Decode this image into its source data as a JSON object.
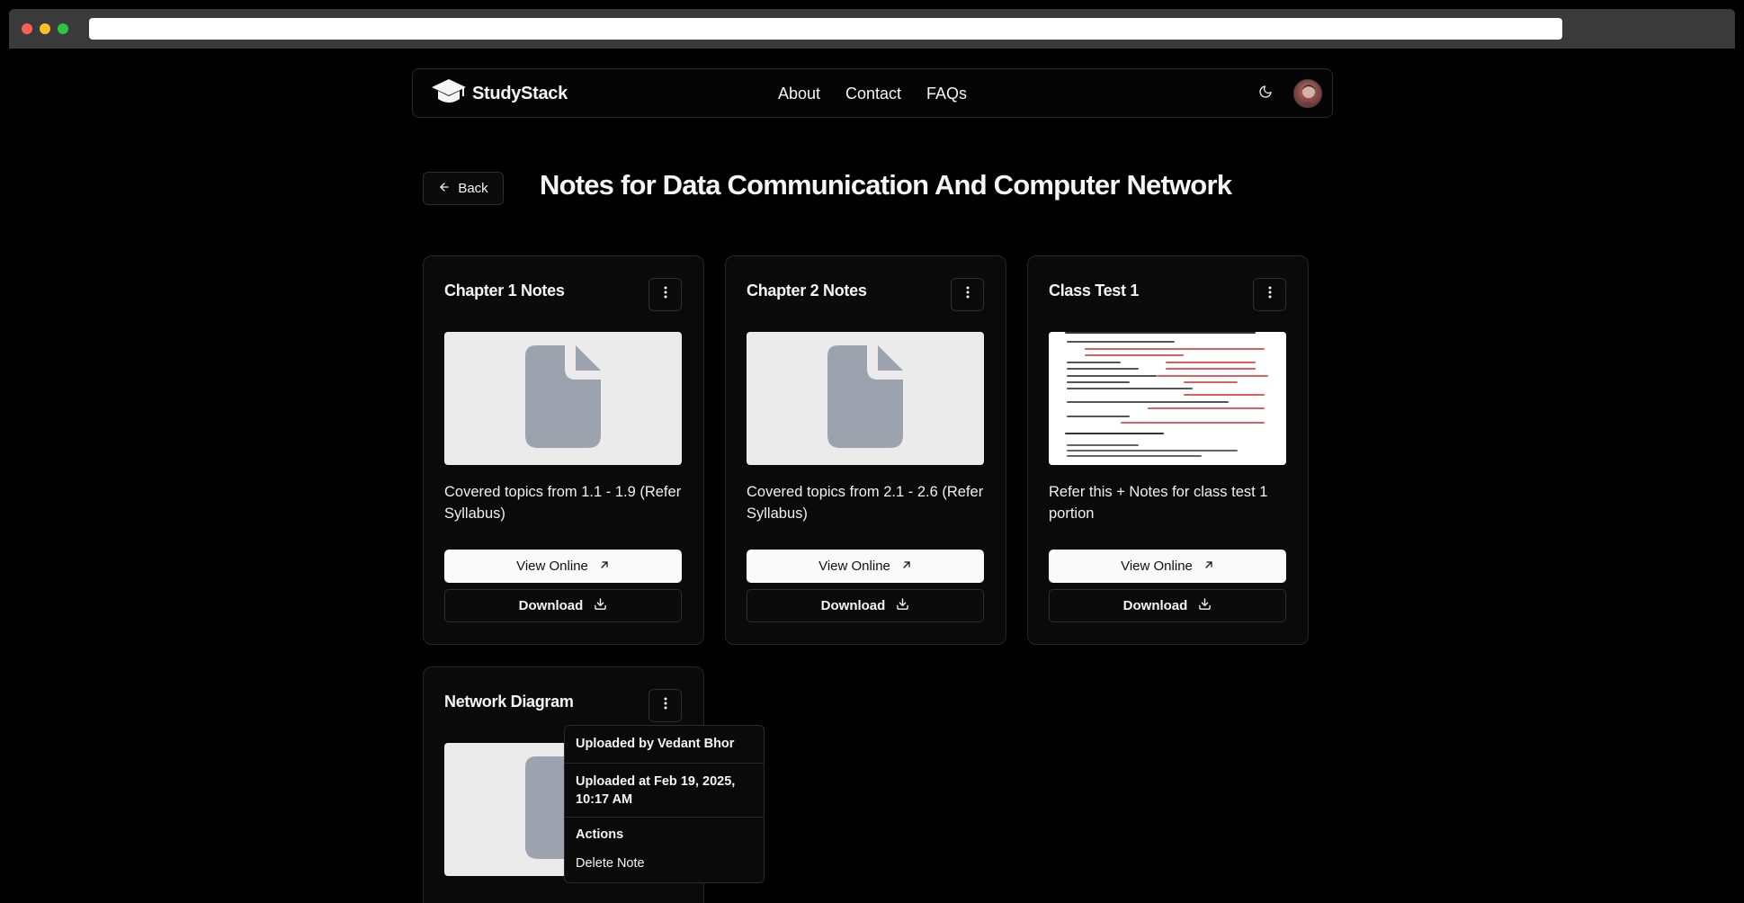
{
  "browser": {
    "url": ""
  },
  "navbar": {
    "brand": "StudyStack",
    "links": [
      "About",
      "Contact",
      "FAQs"
    ]
  },
  "header": {
    "back_label": "Back",
    "title": "Notes for Data Communication And Computer Network"
  },
  "cards": [
    {
      "title": "Chapter 1 Notes",
      "description": "Covered topics from 1.1 - 1.9 (Refer Syllabus)",
      "thumbnail": "file-icon",
      "view_label": "View Online",
      "download_label": "Download"
    },
    {
      "title": "Chapter 2 Notes",
      "description": "Covered topics from 2.1 - 2.6 (Refer Syllabus)",
      "thumbnail": "file-icon",
      "view_label": "View Online",
      "download_label": "Download"
    },
    {
      "title": "Class Test 1",
      "description": "Refer this + Notes for class test 1 portion",
      "thumbnail": "document-preview",
      "view_label": "View Online",
      "download_label": "Download"
    },
    {
      "title": "Network Diagram",
      "thumbnail": "file-icon"
    }
  ],
  "dropdown": {
    "uploaded_by": "Uploaded by Vedant Bhor",
    "uploaded_at": "Uploaded at Feb 19, 2025, 10:17 AM",
    "actions_label": "Actions",
    "delete_label": "Delete Note"
  },
  "colors": {
    "background": "#000000",
    "card": "#0a0a0a",
    "border": "#262626",
    "file_icon": "#9ca3af",
    "thumbnail_bg": "#ebebec",
    "primary_button": "#fafafa",
    "traffic_red": "#ff5f57",
    "traffic_yellow": "#febc2e",
    "traffic_green": "#28c840"
  },
  "icons": {
    "brand": "graduation-cap-icon",
    "theme": "moon-icon",
    "back": "arrow-left-icon",
    "menu": "vertical-ellipsis-icon",
    "view": "arrow-up-right-icon",
    "download": "download-icon"
  }
}
